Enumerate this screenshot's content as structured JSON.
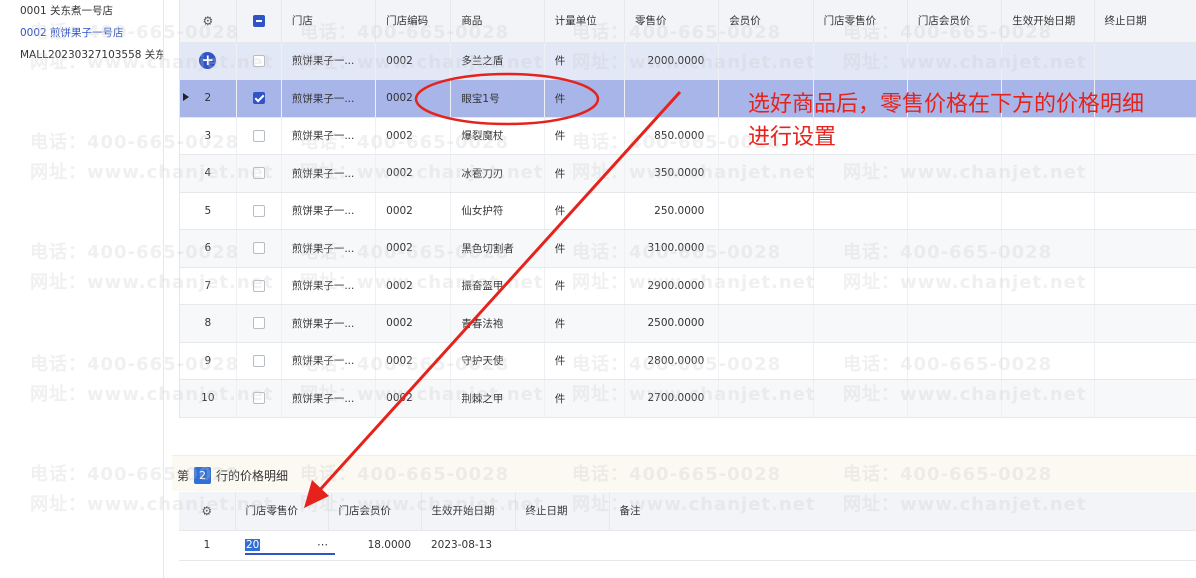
{
  "stores": [
    {
      "label": "0001 关东煮一号店",
      "active": false
    },
    {
      "label": "0002 煎饼果子一号店",
      "active": true
    },
    {
      "label": "MALL20230327103558 关东",
      "active": false
    }
  ],
  "main_table": {
    "headers": [
      "",
      "",
      "门店",
      "门店编码",
      "商品",
      "计量单位",
      "零售价",
      "会员价",
      "门店零售价",
      "门店会员价",
      "生效开始日期",
      "终止日期"
    ],
    "rows": [
      {
        "num": "",
        "checked": false,
        "store": "煎饼果子一...",
        "code": "0002",
        "product": "多兰之盾",
        "unit": "件",
        "retail": "2000.0000"
      },
      {
        "num": "2",
        "checked": true,
        "store": "煎饼果子一...",
        "code": "0002",
        "product": "眼宝1号",
        "unit": "件",
        "retail": ""
      },
      {
        "num": "3",
        "checked": false,
        "store": "煎饼果子一...",
        "code": "0002",
        "product": "爆裂魔杖",
        "unit": "件",
        "retail": "850.0000"
      },
      {
        "num": "4",
        "checked": false,
        "store": "煎饼果子一...",
        "code": "0002",
        "product": "冰雹刀刃",
        "unit": "件",
        "retail": "350.0000"
      },
      {
        "num": "5",
        "checked": false,
        "store": "煎饼果子一...",
        "code": "0002",
        "product": "仙女护符",
        "unit": "件",
        "retail": "250.0000"
      },
      {
        "num": "6",
        "checked": false,
        "store": "煎饼果子一...",
        "code": "0002",
        "product": "黑色切割者",
        "unit": "件",
        "retail": "3100.0000"
      },
      {
        "num": "7",
        "checked": false,
        "store": "煎饼果子一...",
        "code": "0002",
        "product": "振奋盔甲",
        "unit": "件",
        "retail": "2900.0000"
      },
      {
        "num": "8",
        "checked": false,
        "store": "煎饼果子一...",
        "code": "0002",
        "product": "青春法袍",
        "unit": "件",
        "retail": "2500.0000"
      },
      {
        "num": "9",
        "checked": false,
        "store": "煎饼果子一...",
        "code": "0002",
        "product": "守护天使",
        "unit": "件",
        "retail": "2800.0000"
      },
      {
        "num": "10",
        "checked": false,
        "store": "煎饼果子一...",
        "code": "0002",
        "product": "荆棘之甲",
        "unit": "件",
        "retail": "2700.0000"
      }
    ]
  },
  "detail": {
    "title_prefix": "第",
    "row_number": "2",
    "title_suffix": "行的价格明细",
    "headers": [
      "",
      "门店零售价",
      "门店会员价",
      "生效开始日期",
      "终止日期",
      "备注"
    ],
    "rows": [
      {
        "num": "1",
        "store_retail": "20",
        "store_member": "18.0000",
        "start_date": "2023-08-13",
        "end_date": "",
        "note": ""
      }
    ]
  },
  "annotation": {
    "text": "选好商品后，零售价格在下方的价格明细进行设置",
    "color": "#e5231c"
  },
  "watermark": {
    "phone": "电话：400-665-0028",
    "site": "网址：www.chanjet.net"
  },
  "colors": {
    "accent": "#2f54c6",
    "selected_row": "#a8b5e8",
    "annotation_red": "#e5231c"
  },
  "icons": {
    "settings": "gear-icon",
    "add": "plus-circle-icon",
    "current_row": "triangle-right-icon",
    "more": "ellipsis-icon"
  }
}
